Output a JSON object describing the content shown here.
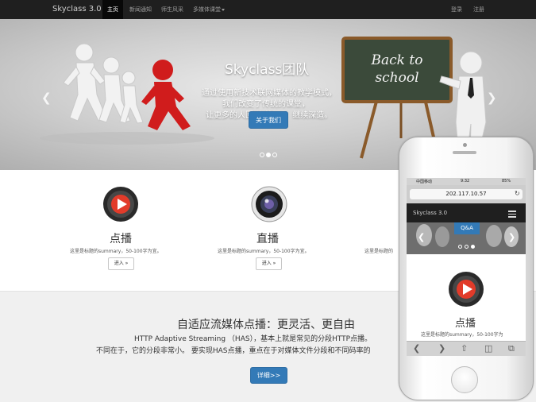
{
  "navbar": {
    "brand": "Skyclass 3.0",
    "items": [
      {
        "label": "主页",
        "active": true
      },
      {
        "label": "新闻通知",
        "active": false
      },
      {
        "label": "师生风采",
        "active": false
      },
      {
        "label": "多媒体课堂",
        "active": false,
        "dropdown": true
      }
    ],
    "login": "登录",
    "register": "注册"
  },
  "hero": {
    "title": "Skyclass团队",
    "lines": [
      "通过使用新技术联网媒体的教学模式，",
      "我们改变了传统的课堂，",
      "让更多的人回到\"校园\"，继续深造。"
    ],
    "button": "关于我们",
    "chalkboard": [
      "Back to",
      "school"
    ],
    "active_slide": 2,
    "slide_count": 3
  },
  "features": [
    {
      "icon": "play-icon",
      "title": "点播",
      "desc": "这里是标题的summary，50-100字为宜。",
      "button": "进入 »"
    },
    {
      "icon": "camera-lens-icon",
      "title": "直播",
      "desc": "这里是标题的summary，50-100字为宜。",
      "button": "进入 »"
    },
    {
      "icon": "third-feature-icon",
      "title": "",
      "desc": "这里是标题的",
      "button": ""
    }
  ],
  "band": {
    "title": "自适应流媒体点播：更灵活、更自由",
    "line1": "HTTP Adaptive Streaming （HAS），基本上就是常见的分段HTTP点播。",
    "line2": "不同在于，它的分段非常小。 要实现HAS点播，重点在于对媒体文件分段和不同码率的",
    "button": "详细>>"
  },
  "phone": {
    "status_carrier": "中国移动",
    "status_time": "9:32",
    "status_battery": "85%",
    "url": "202.117.10.57",
    "brand": "Skyclass 3.0",
    "hero_tag": "Q&A",
    "feature_title": "点播",
    "feature_desc": "这里是标题的summary，50-100字为",
    "toolbar_icons": [
      "back-icon",
      "forward-icon",
      "share-icon",
      "bookmarks-icon",
      "tabs-icon"
    ]
  },
  "colors": {
    "navbar": "#1f1f1f",
    "primary": "#337ab7",
    "band": "#f0f0f0"
  }
}
